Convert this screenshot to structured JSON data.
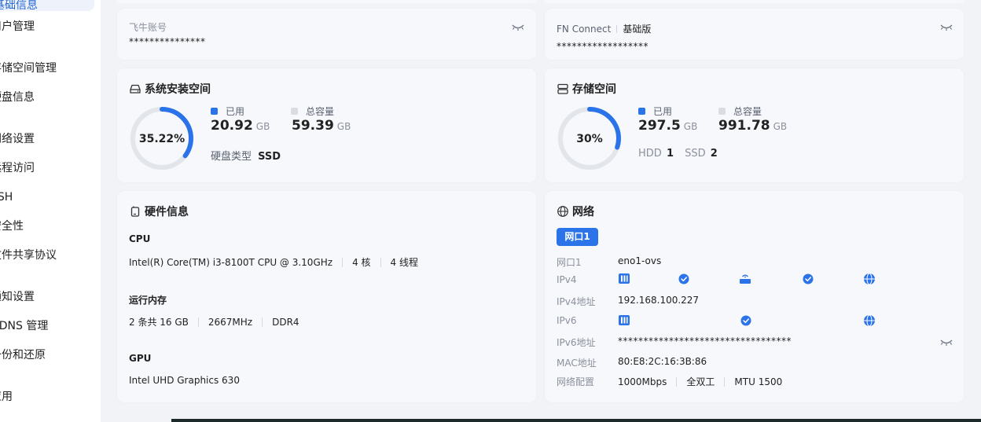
{
  "sidebar": {
    "active": "基础信息",
    "items": [
      "用户管理",
      "存储空间管理",
      "硬盘信息",
      "网络设置",
      "远程访问",
      "SSH",
      "安全性",
      "文件共享协议",
      "通知设置",
      "DDNS 管理",
      "备份和还原",
      "应用"
    ]
  },
  "account": {
    "label": "飞牛账号",
    "value": "***************"
  },
  "fnconnect": {
    "label": "FN Connect",
    "edition": "基础版",
    "value": "******************"
  },
  "system_space": {
    "title": "系统安装空间",
    "percent_label": "35.22%",
    "percent": 35.22,
    "used_label": "已用",
    "used_value": "20.92",
    "used_unit": "GB",
    "total_label": "总容量",
    "total_value": "59.39",
    "total_unit": "GB",
    "disk_type_label": "硬盘类型",
    "disk_type_value": "SSD"
  },
  "storage_space": {
    "title": "存储空间",
    "percent_label": "30%",
    "percent": 30,
    "used_label": "已用",
    "used_value": "297.5",
    "used_unit": "GB",
    "total_label": "总容量",
    "total_value": "991.78",
    "total_unit": "GB",
    "hdd_label": "HDD",
    "hdd_count": "1",
    "ssd_label": "SSD",
    "ssd_count": "2"
  },
  "hardware": {
    "title": "硬件信息",
    "cpu_heading": "CPU",
    "cpu_model": "Intel(R) Core(TM) i3-8100T CPU @ 3.10GHz",
    "cpu_cores": "4 核",
    "cpu_threads": "4 线程",
    "mem_heading": "运行内存",
    "mem_size": "2 条共 16 GB",
    "mem_speed": "2667MHz",
    "mem_type": "DDR4",
    "gpu_heading": "GPU",
    "gpu_model": "Intel UHD Graphics 630"
  },
  "network": {
    "title": "网络",
    "tab": "网口1",
    "port_label": "网口1",
    "port_value": "eno1-ovs",
    "ipv4_label": "IPv4",
    "ipv4_addr_label": "IPv4地址",
    "ipv4_addr": "192.168.100.227",
    "ipv6_label": "IPv6",
    "ipv6_addr_label": "IPv6地址",
    "ipv6_addr": "**********************************",
    "mac_label": "MAC地址",
    "mac_value": "80:E8:2C:16:3B:86",
    "config_label": "网络配置",
    "speed": "1000Mbps",
    "duplex": "全双工",
    "mtu": "MTU 1500"
  },
  "colors": {
    "accent": "#2b73e8",
    "ring_track": "#e2e5ea",
    "total_square": "#d9dce2"
  }
}
